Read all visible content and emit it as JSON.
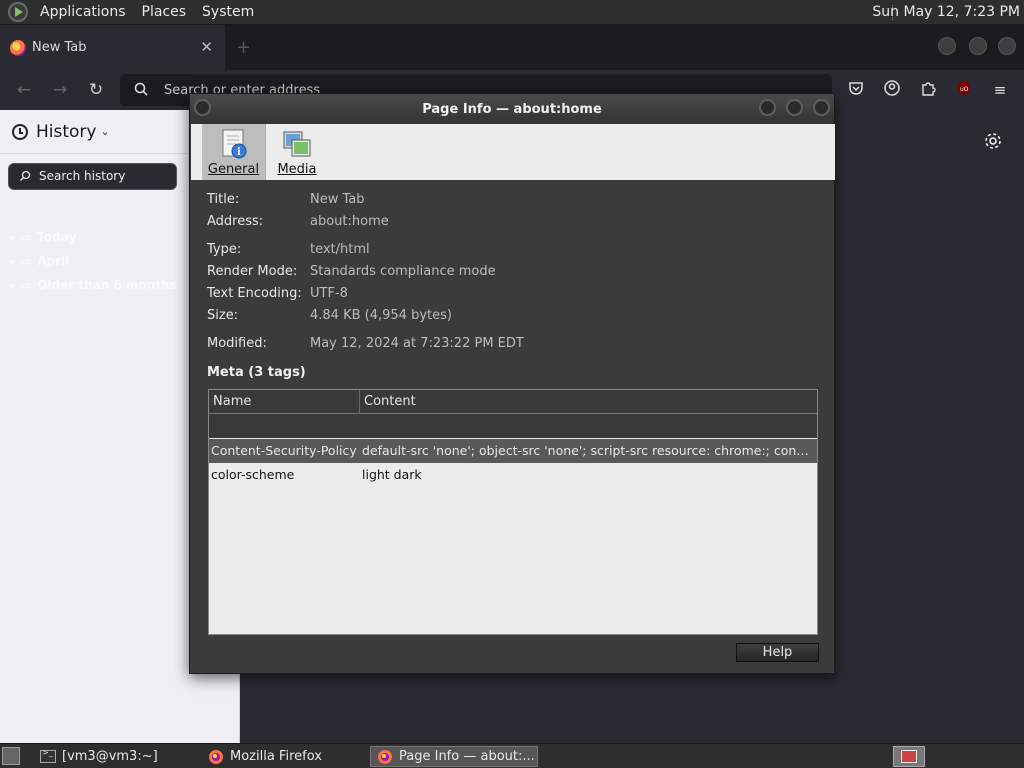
{
  "top_panel": {
    "menus": [
      "Applications",
      "Places",
      "System"
    ],
    "clock": "Sun May 12,  7:23 PM"
  },
  "firefox": {
    "tab": {
      "title": "New Tab"
    },
    "urlbar": {
      "placeholder": "Search or enter address"
    },
    "sidebar": {
      "title": "History",
      "search_placeholder": "Search history",
      "items": [
        "Today",
        "April",
        "Older than 6 months"
      ]
    }
  },
  "dialog": {
    "title": "Page Info — about:home",
    "tabs": [
      "General",
      "Media"
    ],
    "fields": [
      {
        "label": "Title:",
        "value": "New Tab"
      },
      {
        "label": "Address:",
        "value": "about:home"
      },
      {
        "label": "Type:",
        "value": "text/html"
      },
      {
        "label": "Render Mode:",
        "value": "Standards compliance mode"
      },
      {
        "label": "Text Encoding:",
        "value": "UTF-8"
      },
      {
        "label": "Size:",
        "value": "4.84 KB (4,954 bytes)"
      },
      {
        "label": "Modified:",
        "value": "May 12, 2024 at 7:23:22 PM EDT"
      }
    ],
    "meta_title": "Meta (3 tags)",
    "meta_columns": [
      "Name",
      "Content"
    ],
    "meta_rows": [
      {
        "name": "Content-Security-Policy",
        "content": "default-src 'none'; object-src 'none'; script-src resource: chrome:; connect-src https:; img-src https: data: blob: chrome:; style-src 'unsafe-inline';"
      },
      {
        "name": "color-scheme",
        "content": "light dark"
      }
    ],
    "help_label": "Help"
  },
  "taskbar": {
    "tasks": [
      "[vm3@vm3:~]",
      "Mozilla Firefox",
      "Page Info — about:..."
    ]
  }
}
